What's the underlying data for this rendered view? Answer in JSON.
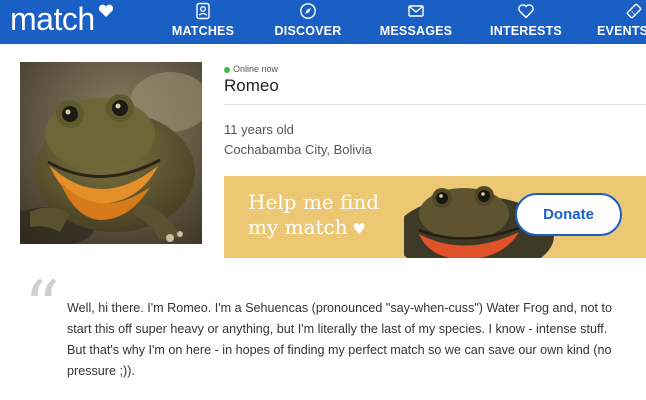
{
  "app": {
    "logo_text": "match"
  },
  "nav": [
    {
      "label": "MATCHES",
      "icon": "profile-card-icon"
    },
    {
      "label": "DISCOVER",
      "icon": "compass-icon"
    },
    {
      "label": "MESSAGES",
      "icon": "envelope-icon"
    },
    {
      "label": "INTERESTS",
      "icon": "heart-icon"
    },
    {
      "label": "EVENTS",
      "icon": "ticket-icon"
    }
  ],
  "profile": {
    "status": "Online now",
    "name": "Romeo",
    "age": "11 years old",
    "location": "Cochabamba City, Bolivia"
  },
  "banner": {
    "text_line1": "Help me find",
    "text_line2": "my match",
    "donate_label": "Donate"
  },
  "bio": "Well, hi there. I'm Romeo. I'm a Sehuencas (pronounced \"say-when-cuss\") Water Frog and, not to start this off super heavy or anything, but I'm literally the last of my species. I know - intense stuff. But that's why I'm on here - in hopes of finding my perfect match so we can save our own kind (no pressure ;)).",
  "colors": {
    "brand_blue": "#1a5fc4",
    "banner_yellow": "#ecc874",
    "online_green": "#3fb94e"
  }
}
